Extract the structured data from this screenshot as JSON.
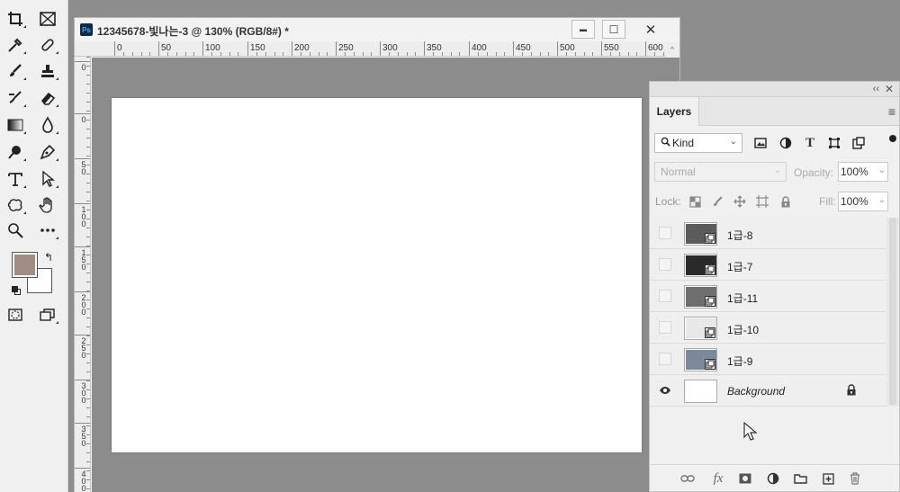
{
  "document": {
    "title": "12345678-빛나는-3 @ 130% (RGB/8#) *",
    "app_badge": "Ps",
    "ruler_h": [
      "0",
      "50",
      "100",
      "150",
      "200",
      "250",
      "300",
      "350",
      "400",
      "450",
      "500",
      "550",
      "600"
    ],
    "ruler_v": [
      "0",
      "0",
      "5\n0",
      "1\n0\n0",
      "1\n5\n0",
      "2\n0\n0",
      "2\n5\n0",
      "3\n0\n0",
      "3\n5\n0",
      "4\n0\n0"
    ],
    "minimize": "▬",
    "maximize": "☐",
    "close": "✕",
    "scroll_up": "^"
  },
  "layers_panel": {
    "collapse": "‹‹",
    "close": "✕",
    "tab_label": "Layers",
    "menu": "≡",
    "kind_label": "Kind",
    "kind_chevron": "⌄",
    "filter_icons": [
      "image-filter-icon",
      "adjustment-filter-icon",
      "type-filter-icon",
      "shape-filter-icon",
      "smart-object-filter-icon"
    ],
    "blend_mode": "Normal",
    "opacity_label": "Opacity:",
    "opacity_value": "100%",
    "lock_label": "Lock:",
    "fill_label": "Fill:",
    "fill_value": "100%",
    "layers": [
      {
        "name": "1급-8",
        "visible": false,
        "thumb_color": "#5b5b5b"
      },
      {
        "name": "1급-7",
        "visible": false,
        "thumb_color": "#2a2a2a"
      },
      {
        "name": "1급-11",
        "visible": false,
        "thumb_color": "#6e6e6e"
      },
      {
        "name": "1급-10",
        "visible": false,
        "thumb_color": "#e8e8e8"
      },
      {
        "name": "1급-9",
        "visible": false,
        "thumb_color": "#7a8a9a"
      },
      {
        "name": "Background",
        "visible": true,
        "thumb_color": "#ffffff",
        "locked": true
      }
    ],
    "bottom_icons": [
      "link-icon",
      "fx-icon",
      "mask-icon",
      "adjustment-icon",
      "folder-icon",
      "new-layer-icon",
      "trash-icon"
    ],
    "fx_label": "fx"
  },
  "tools": {
    "foreground_color": "#a08c80",
    "background_color": "#ffffff"
  }
}
